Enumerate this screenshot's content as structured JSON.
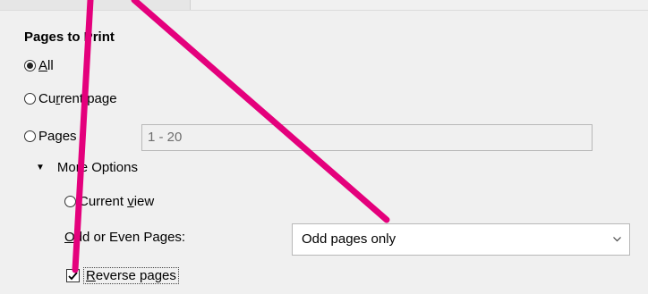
{
  "section_title": "Pages to Print",
  "radios": {
    "all": {
      "pre": "",
      "u": "A",
      "post": "ll"
    },
    "current_page": {
      "pre": "Cu",
      "u": "r",
      "post": "rent page"
    },
    "pages": {
      "pre": "Pa",
      "u": "g",
      "post": "es"
    }
  },
  "pages_input": {
    "value": "1 - 20"
  },
  "more_options": {
    "label": "More Options",
    "icon": "triangle-down-icon"
  },
  "current_view": {
    "pre": "Current ",
    "u": "v",
    "post": "iew"
  },
  "odd_even": {
    "label_pre": "",
    "label_u": "O",
    "label_post": "dd or Even Pages:",
    "selected": "Odd pages only"
  },
  "reverse_pages": {
    "pre": "",
    "u": "R",
    "post": "everse pages",
    "checked": true
  },
  "annotation": {
    "color": "#e4007c"
  }
}
